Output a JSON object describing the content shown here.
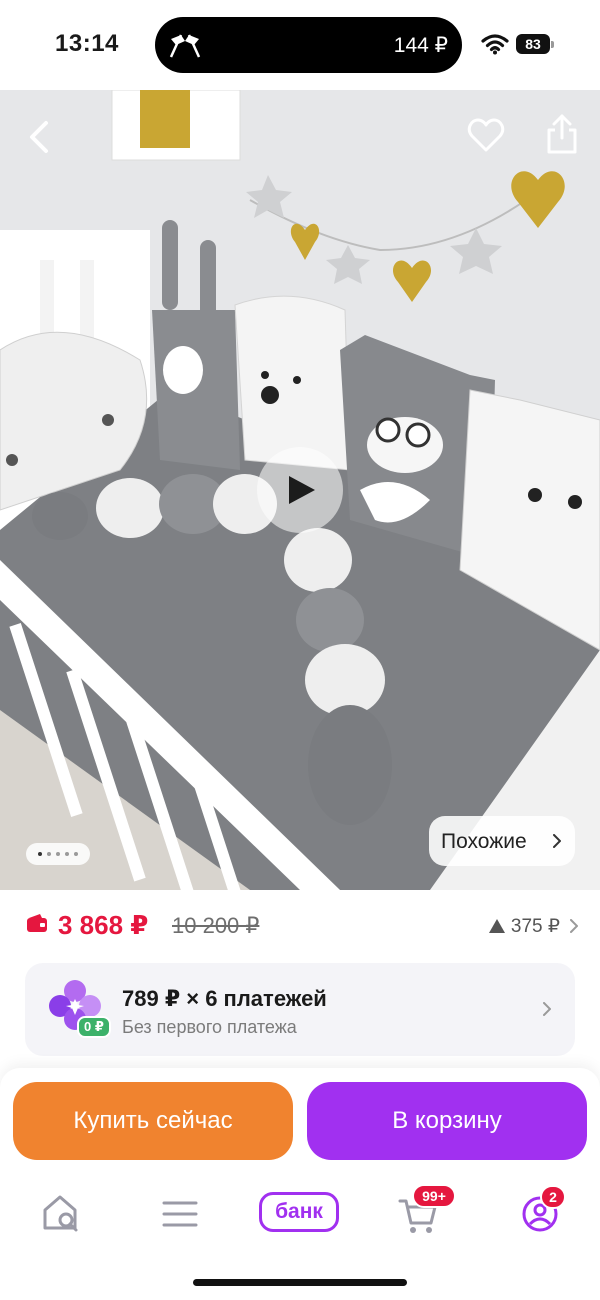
{
  "status_bar": {
    "time": "13:14",
    "island_amount": "144 ₽",
    "battery": "83",
    "island_icon": "checkered-flags-icon",
    "wifi_icon": "wifi-icon"
  },
  "product_photo": {
    "nav_icons": [
      "back-chevron-icon",
      "heart-icon",
      "share-icon"
    ],
    "play_icon": "play-icon",
    "photo_count": 5,
    "active_photo": 1,
    "similar_label": "Похожие"
  },
  "price": {
    "current": "3 868 ₽",
    "old": "10 200 ₽",
    "bonus": "375 ₽",
    "accent_color": "#e5173f"
  },
  "installment": {
    "title": "789 ₽ × 6 платежей",
    "subtitle": "Без первого платежа",
    "badge": "0 ₽"
  },
  "actions": {
    "buy_now": "Купить сейчас",
    "add_to_cart": "В корзину",
    "buy_color": "#f0832f",
    "cart_color": "#a130f0"
  },
  "tabbar": {
    "bank_label": "банк",
    "cart_badge": "99+",
    "profile_badge": "2",
    "icons": [
      "home-search-icon",
      "menu-icon",
      "bank-icon",
      "cart-icon",
      "profile-icon"
    ]
  }
}
